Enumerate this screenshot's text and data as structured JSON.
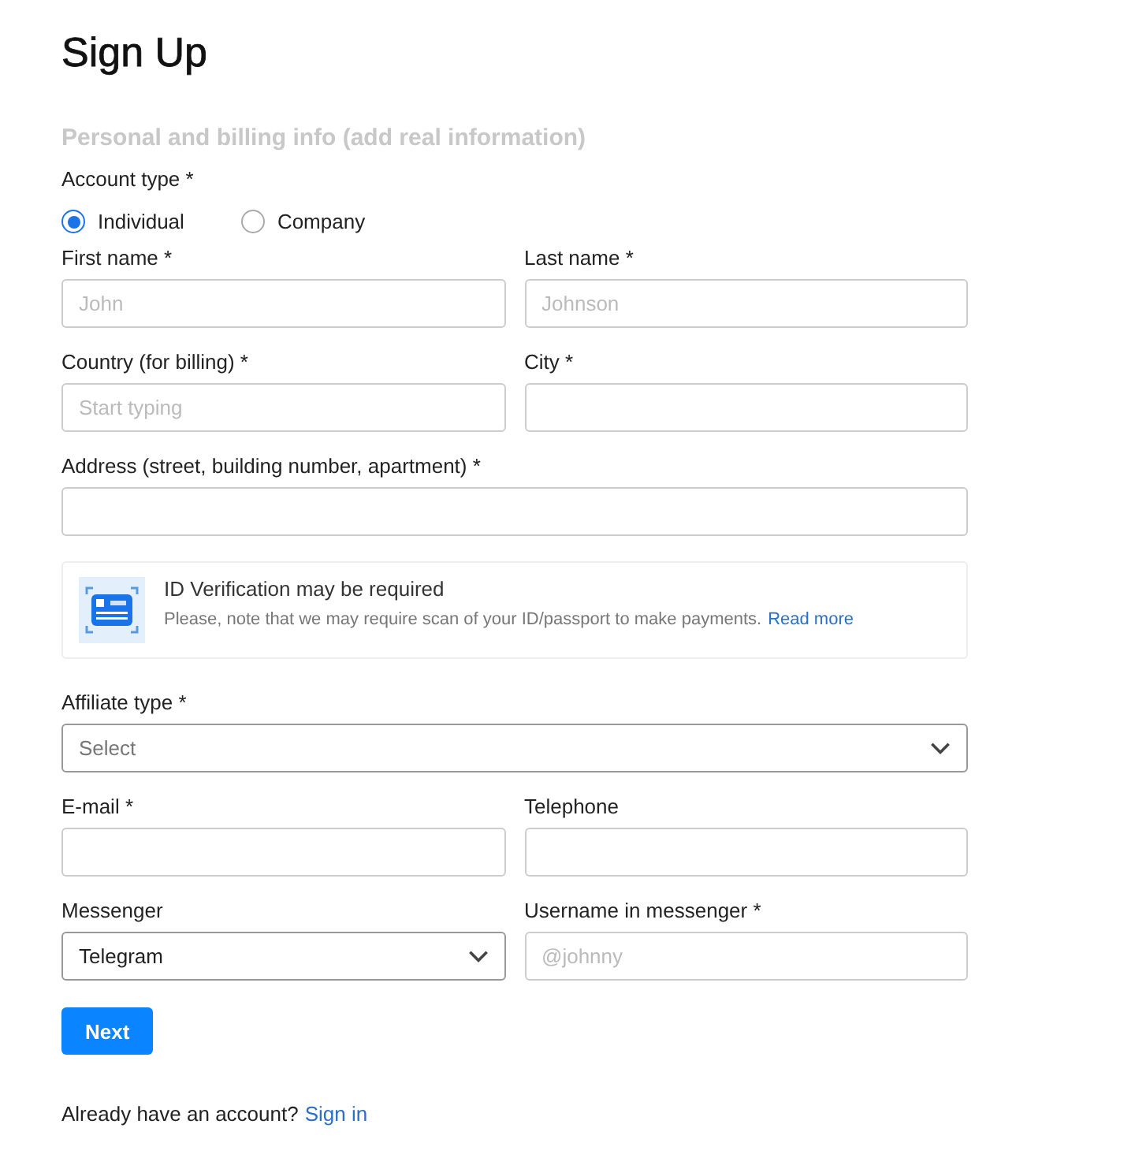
{
  "title": "Sign Up",
  "section_heading": "Personal and billing info (add real information)",
  "account_type": {
    "label": "Account type *",
    "options": [
      {
        "label": "Individual",
        "selected": true
      },
      {
        "label": "Company",
        "selected": false
      }
    ]
  },
  "rows_before_notice": [
    {
      "fields": [
        {
          "kind": "text",
          "label": "First name *",
          "placeholder": "John"
        },
        {
          "kind": "text",
          "label": "Last name *",
          "placeholder": "Johnson"
        }
      ]
    },
    {
      "fields": [
        {
          "kind": "text",
          "label": "Country (for billing) *",
          "placeholder": "Start typing"
        },
        {
          "kind": "text",
          "label": "City *"
        }
      ]
    },
    {
      "fields": [
        {
          "kind": "text",
          "label": "Address (street, building number, apartment) *"
        }
      ]
    }
  ],
  "notice": {
    "title": "ID Verification may be required",
    "text": "Please, note that we may require scan of your ID/passport to make payments.",
    "link": "Read more"
  },
  "rows_after_notice": [
    {
      "fields": [
        {
          "kind": "select",
          "label": "Affiliate type *",
          "placeholder": "Select"
        }
      ]
    },
    {
      "fields": [
        {
          "kind": "text",
          "label": "E-mail *"
        },
        {
          "kind": "text",
          "label": "Telephone"
        }
      ]
    },
    {
      "fields": [
        {
          "kind": "select",
          "label": "Messenger",
          "value": "Telegram"
        },
        {
          "kind": "text",
          "label": "Username in messenger *",
          "placeholder": "@johnny"
        }
      ]
    }
  ],
  "next_button": "Next",
  "footer": {
    "text": "Already have an account?",
    "link": "Sign in"
  }
}
